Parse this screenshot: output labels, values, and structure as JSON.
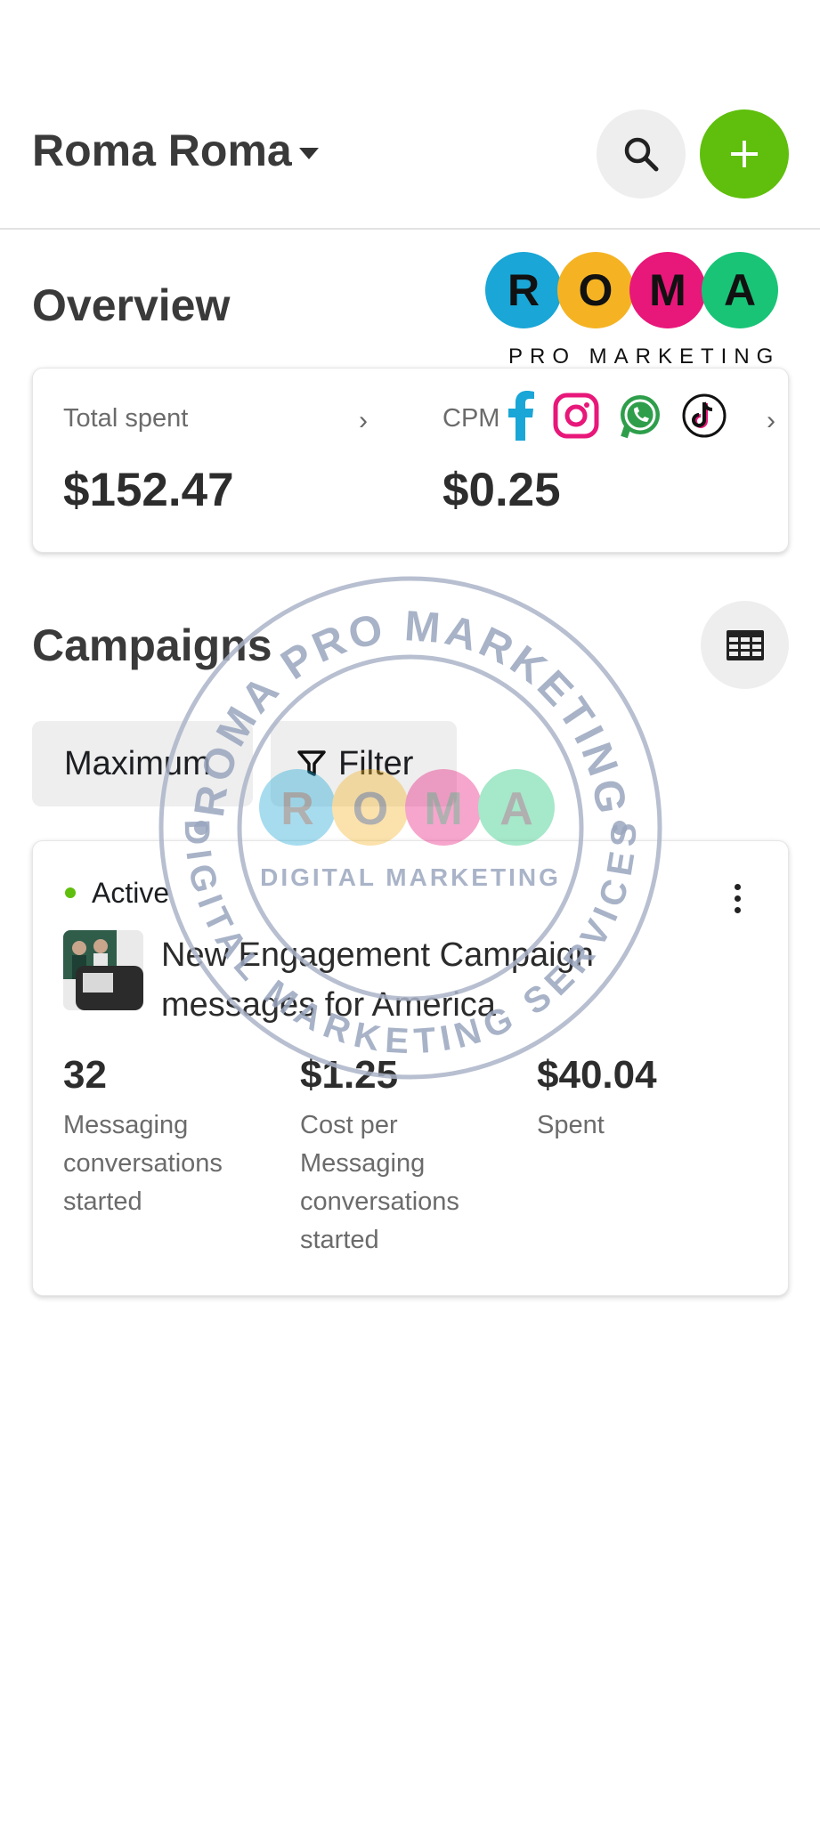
{
  "header": {
    "account_name": "Roma Roma"
  },
  "overview": {
    "title": "Overview",
    "metrics": [
      {
        "label": "Total spent",
        "value": "$152.47"
      },
      {
        "label": "CPM",
        "value": "$0.25"
      }
    ]
  },
  "logo": {
    "letters": [
      "R",
      "O",
      "M",
      "A"
    ],
    "tagline": "PRO MARKETING",
    "colors": [
      "#1aa6d6",
      "#f5b324",
      "#e8177a",
      "#19c477"
    ]
  },
  "campaigns": {
    "title": "Campaigns",
    "sort_chip": "Maximum",
    "filter_chip": "Filter",
    "items": [
      {
        "status": "Active",
        "name": "New Engagement Campaign messages for America",
        "stats": [
          {
            "value": "32",
            "label": "Messaging conversations started"
          },
          {
            "value": "$1.25",
            "label": "Cost per Messaging conversations started"
          },
          {
            "value": "$40.04",
            "label": "Spent"
          }
        ]
      }
    ]
  },
  "watermark": {
    "top_text": "ROMA PRO MARKETING",
    "bottom_text": "DIGITAL MARKETING SERVICES",
    "center_letters": [
      "R",
      "O",
      "M",
      "A"
    ],
    "center_subtitle": "DIGITAL MARKETING"
  },
  "colors": {
    "accent_green": "#5fbf0c",
    "button_gray": "#eeeeee"
  }
}
